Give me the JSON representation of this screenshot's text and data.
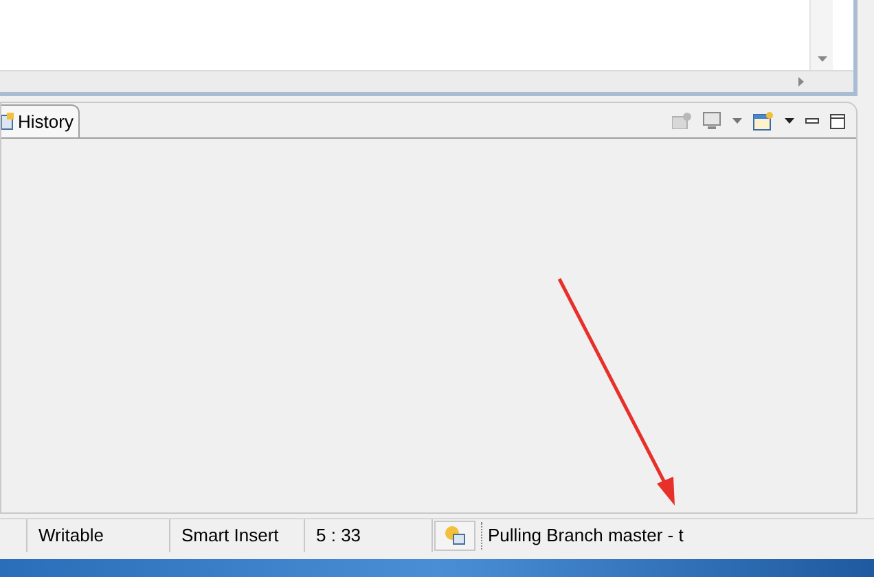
{
  "bottom_panel": {
    "tabs": [
      {
        "label": "History",
        "selected": true
      }
    ]
  },
  "status_bar": {
    "items": [
      "Writable",
      "Smart Insert",
      "5 : 33"
    ],
    "progress_text": "Pulling Branch master - t"
  },
  "annotation": {
    "kind": "arrow"
  }
}
